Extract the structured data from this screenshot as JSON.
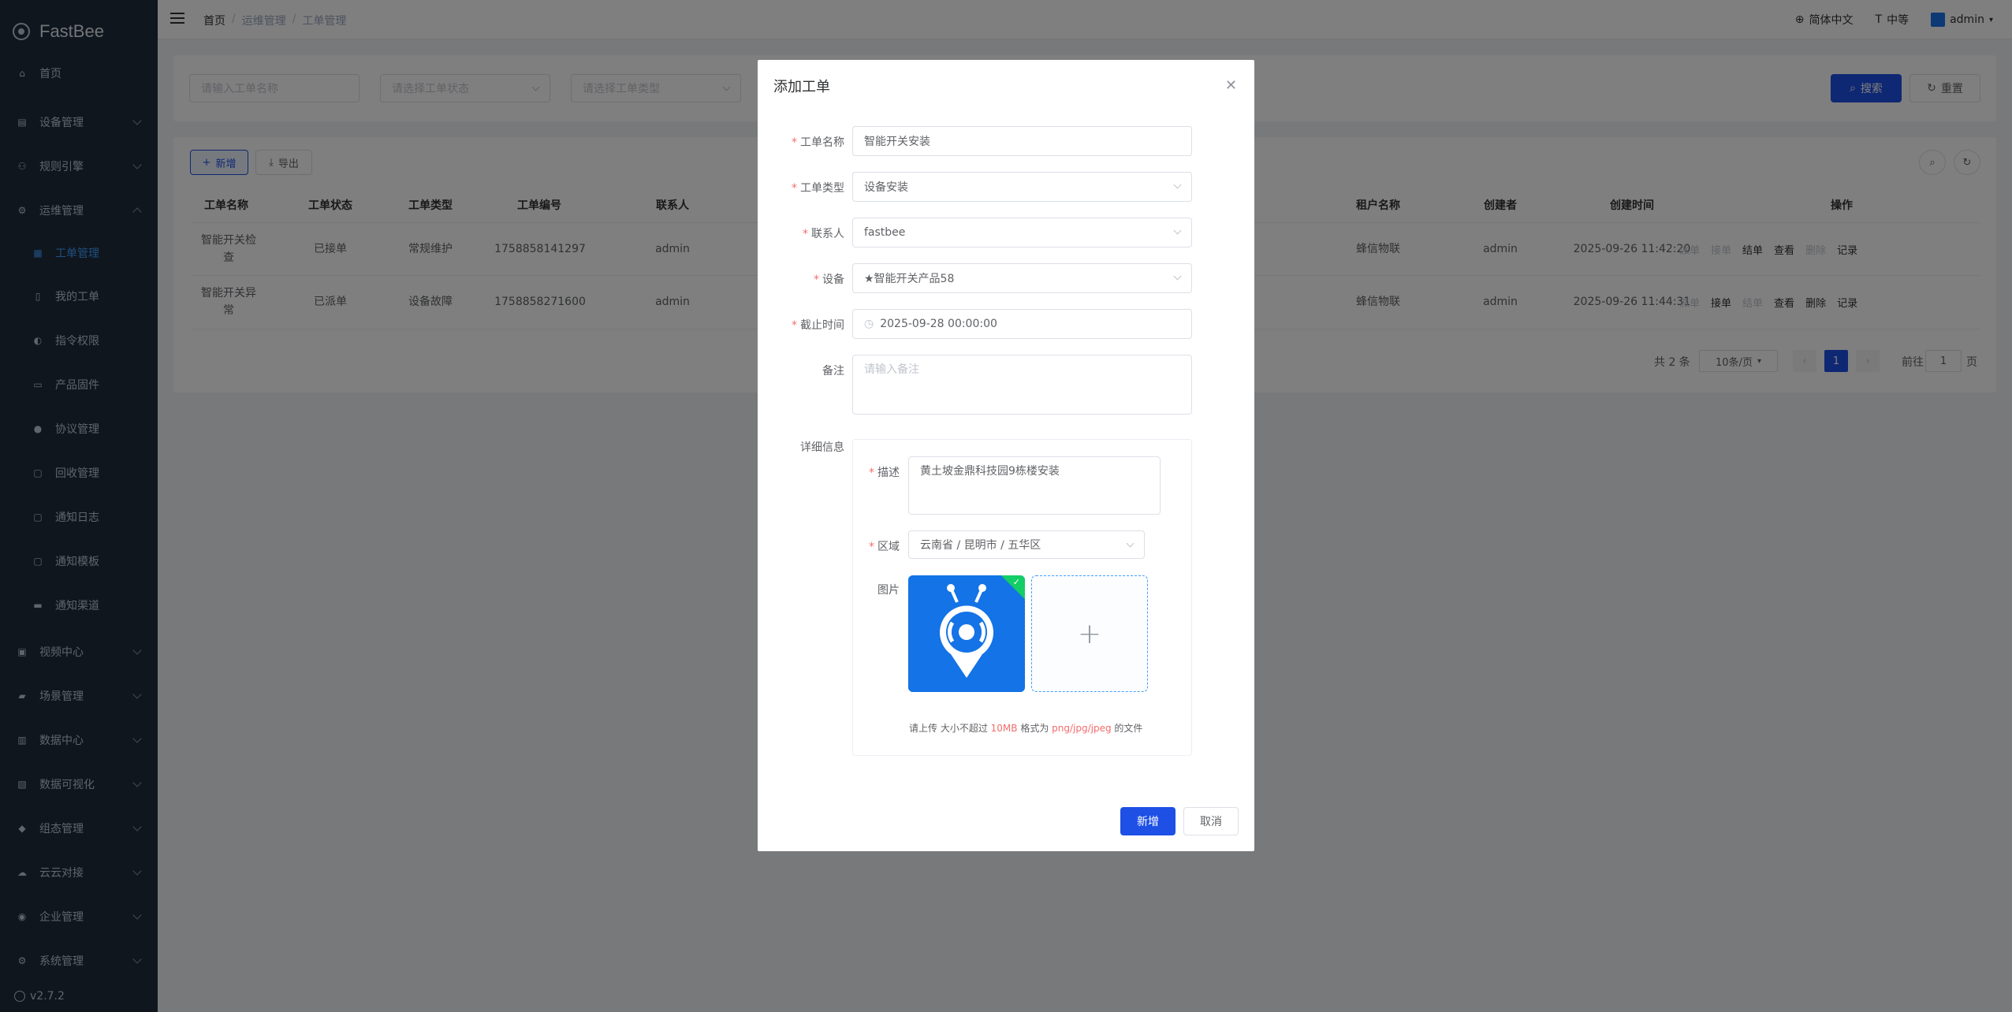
{
  "brand": {
    "name": "FastBee"
  },
  "sidebar": {
    "items": [
      {
        "label": "首页",
        "icon": "home-icon"
      },
      {
        "label": "设备管理",
        "icon": "device-icon"
      },
      {
        "label": "规则引擎",
        "icon": "rule-icon"
      },
      {
        "label": "运维管理",
        "icon": "ops-icon"
      },
      {
        "label": "工单管理",
        "icon": "workorder-icon"
      },
      {
        "label": "我的工单",
        "icon": "my-order-icon"
      },
      {
        "label": "指令权限",
        "icon": "toggle-icon"
      },
      {
        "label": "产品固件",
        "icon": "firmware-icon"
      },
      {
        "label": "协议管理",
        "icon": "protocol-icon"
      },
      {
        "label": "回收管理",
        "icon": "recycle-icon"
      },
      {
        "label": "通知日志",
        "icon": "log-icon"
      },
      {
        "label": "通知模板",
        "icon": "template-icon"
      },
      {
        "label": "通知渠道",
        "icon": "channel-icon"
      },
      {
        "label": "视频中心",
        "icon": "video-icon"
      },
      {
        "label": "场景管理",
        "icon": "scene-icon"
      },
      {
        "label": "数据中心",
        "icon": "data-icon"
      },
      {
        "label": "数据可视化",
        "icon": "visual-icon"
      },
      {
        "label": "组态管理",
        "icon": "config-icon"
      },
      {
        "label": "云云对接",
        "icon": "cloud-icon"
      },
      {
        "label": "企业管理",
        "icon": "enterprise-icon"
      },
      {
        "label": "系统管理",
        "icon": "system-icon"
      }
    ],
    "version": "v2.7.2"
  },
  "header": {
    "breadcrumb": [
      "首页",
      "运维管理",
      "工单管理"
    ],
    "separator": "/",
    "language": "简体中文",
    "size": "中等",
    "user": "admin"
  },
  "search": {
    "name_placeholder": "请输入工单名称",
    "status_placeholder": "请选择工单状态",
    "type_placeholder": "请选择工单类型",
    "search_label": "搜索",
    "reset_label": "重置"
  },
  "toolbar": {
    "add_label": "新增",
    "export_label": "导出"
  },
  "table": {
    "columns": [
      "工单名称",
      "工单状态",
      "工单类型",
      "工单编号",
      "联系人",
      "租户名称",
      "创建者",
      "创建时间",
      "操作"
    ],
    "rows": [
      {
        "name_line1": "智能开关检",
        "name_line2": "查",
        "status": "已接单",
        "type": "常规维护",
        "number": "1758858141297",
        "contact": "admin",
        "tenant": "蜂信物联",
        "creator": "admin",
        "time": "2025-09-26 11:42:20",
        "ops": [
          "派单",
          "接单",
          "结单",
          "查看",
          "删除",
          "记录"
        ]
      },
      {
        "name_line1": "智能开关异",
        "name_line2": "常",
        "status": "已派单",
        "type": "设备故障",
        "number": "1758858271600",
        "contact": "admin",
        "tenant": "蜂信物联",
        "creator": "admin",
        "time": "2025-09-26 11:44:31",
        "ops": [
          "派单",
          "接单",
          "结单",
          "查看",
          "删除",
          "记录"
        ]
      }
    ]
  },
  "pagination": {
    "total": "共 2 条",
    "page_size": "10条/页",
    "current": "1",
    "goto_prefix": "前往",
    "goto_value": "1",
    "goto_suffix": "页"
  },
  "dialog": {
    "title": "添加工单",
    "fields": {
      "name": {
        "label": "工单名称",
        "value": "智能开关安装"
      },
      "type": {
        "label": "工单类型",
        "value": "设备安装"
      },
      "contact": {
        "label": "联系人",
        "value": "fastbee"
      },
      "device": {
        "label": "设备",
        "value": "★智能开关产品58"
      },
      "deadline": {
        "label": "截止时间",
        "value": "2025-09-28 00:00:00"
      },
      "remark": {
        "label": "备注",
        "placeholder": "请输入备注"
      },
      "detail": {
        "label": "详细信息"
      },
      "desc": {
        "label": "描述",
        "value": "黄土坡金鼎科技园9栋楼安装"
      },
      "region": {
        "label": "区域",
        "value": "云南省 / 昆明市 / 五华区"
      },
      "image": {
        "label": "图片"
      }
    },
    "upload_tip": {
      "p1": "请上传 大小不超过 ",
      "size": "10MB",
      "p2": " 格式为 ",
      "formats": "png/jpg/jpeg",
      "p3": " 的文件"
    },
    "submit_label": "新增",
    "cancel_label": "取消"
  },
  "colors": {
    "primary": "#1e50e6",
    "sidebar_bg": "#1f2d3d",
    "danger": "#f56c6c",
    "success": "#13ce66"
  }
}
